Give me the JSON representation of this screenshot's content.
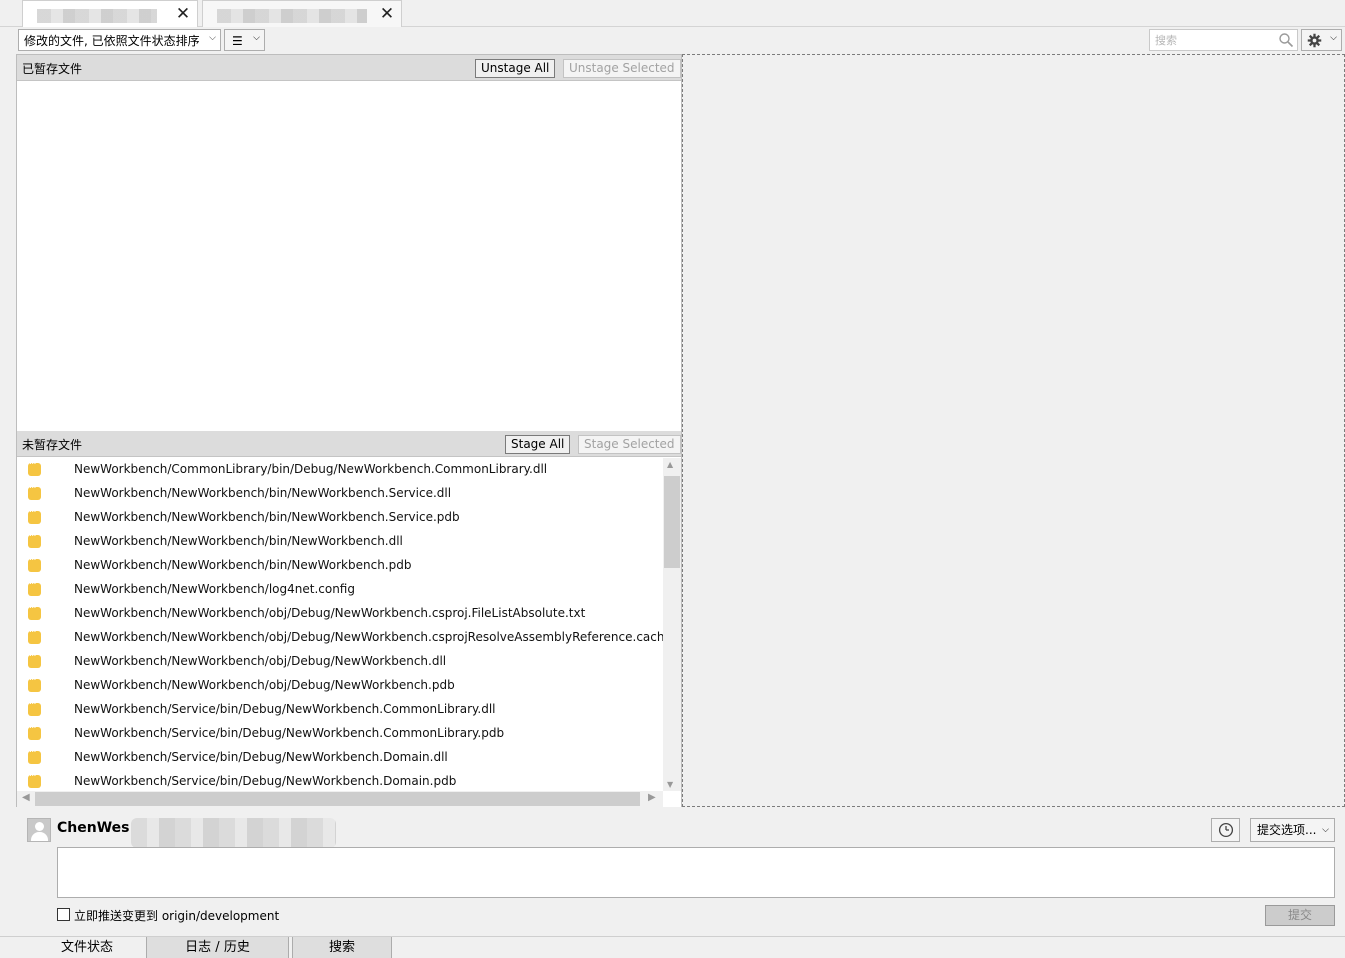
{
  "doc_tabs": [
    {
      "label": "",
      "close_glyph": "✕"
    },
    {
      "label": "",
      "close_glyph": "✕"
    }
  ],
  "toolbar": {
    "sort_combo": "修改的文件, 已依照文件状态排序",
    "search_placeholder": "搜索"
  },
  "staged": {
    "title": "已暂存文件",
    "unstage_all": "Unstage All",
    "unstage_selected": "Unstage Selected"
  },
  "unstaged": {
    "title": "未暂存文件",
    "stage_all": "Stage All",
    "stage_selected": "Stage Selected",
    "files": [
      "NewWorkbench/CommonLibrary/bin/Debug/NewWorkbench.CommonLibrary.dll",
      "NewWorkbench/NewWorkbench/bin/NewWorkbench.Service.dll",
      "NewWorkbench/NewWorkbench/bin/NewWorkbench.Service.pdb",
      "NewWorkbench/NewWorkbench/bin/NewWorkbench.dll",
      "NewWorkbench/NewWorkbench/bin/NewWorkbench.pdb",
      "NewWorkbench/NewWorkbench/log4net.config",
      "NewWorkbench/NewWorkbench/obj/Debug/NewWorkbench.csproj.FileListAbsolute.txt",
      "NewWorkbench/NewWorkbench/obj/Debug/NewWorkbench.csprojResolveAssemblyReference.cache",
      "NewWorkbench/NewWorkbench/obj/Debug/NewWorkbench.dll",
      "NewWorkbench/NewWorkbench/obj/Debug/NewWorkbench.pdb",
      "NewWorkbench/Service/bin/Debug/NewWorkbench.CommonLibrary.dll",
      "NewWorkbench/Service/bin/Debug/NewWorkbench.CommonLibrary.pdb",
      "NewWorkbench/Service/bin/Debug/NewWorkbench.Domain.dll",
      "NewWorkbench/Service/bin/Debug/NewWorkbench.Domain.pdb"
    ]
  },
  "commit": {
    "username": "ChenWes",
    "options_label": "提交选项...",
    "push_label": "立即推送变更到 origin/development",
    "push_checked": false,
    "submit_label": "提交"
  },
  "bottom_tabs": [
    "文件状态",
    "日志 / 历史",
    "搜索"
  ],
  "colors": {
    "status_modified": "#f5c542",
    "header_bg": "#dcdcdc"
  }
}
